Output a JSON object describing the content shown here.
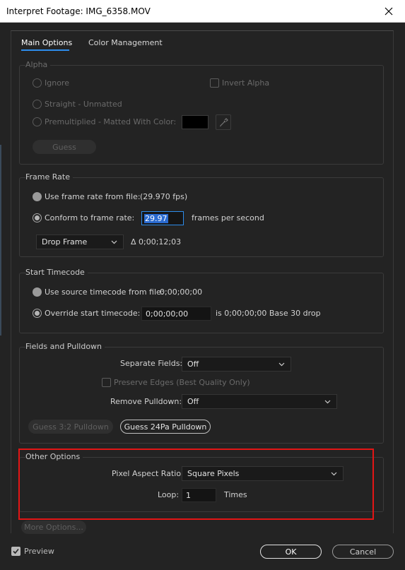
{
  "window": {
    "title": "Interpret Footage: IMG_6358.MOV",
    "close_icon": "close-icon"
  },
  "tabs": [
    {
      "label": "Main Options",
      "active": true
    },
    {
      "label": "Color Management",
      "active": false
    }
  ],
  "alpha": {
    "title": "Alpha",
    "ignore": "Ignore",
    "invert": "Invert Alpha",
    "straight": "Straight - Unmatted",
    "premultiplied": "Premultiplied - Matted With Color:",
    "guess": "Guess",
    "matte_color": "#000000"
  },
  "frame_rate": {
    "title": "Frame Rate",
    "use_from_file": "Use frame rate from file:",
    "file_fps": "(29.970 fps)",
    "conform": "Conform to frame rate:",
    "conform_value": "29.97",
    "fps_unit": "frames per second",
    "drop_frame": "Drop Frame",
    "delta": "Δ 0;00;12;03"
  },
  "start_timecode": {
    "title": "Start Timecode",
    "use_source": "Use source timecode from file:",
    "source_value": "0;00;00;00",
    "override": "Override start timecode:",
    "override_value": "0;00;00;00",
    "info": "is 0;00;00;00  Base 30  drop"
  },
  "fields": {
    "title": "Fields and Pulldown",
    "separate_label": "Separate Fields:",
    "separate_value": "Off",
    "preserve_edges": "Preserve Edges (Best Quality Only)",
    "remove_label": "Remove Pulldown:",
    "remove_value": "Off",
    "guess32": "Guess 3:2 Pulldown",
    "guess24": "Guess 24Pa Pulldown"
  },
  "other": {
    "title": "Other Options",
    "par_label": "Pixel Aspect Ratio:",
    "par_value": "Square Pixels",
    "loop_label": "Loop:",
    "loop_value": "1",
    "loop_unit": "Times"
  },
  "more_options": "More Options...",
  "footer": {
    "preview": "Preview",
    "preview_checked": true,
    "ok": "OK",
    "cancel": "Cancel"
  },
  "colors": {
    "accent": "#2d8ceb",
    "highlight": "#e31515",
    "background": "#232323"
  }
}
